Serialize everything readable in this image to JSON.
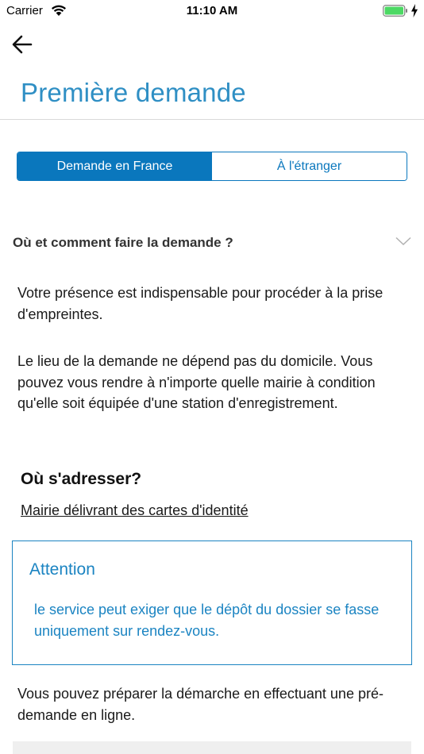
{
  "status_bar": {
    "carrier": "Carrier",
    "time": "11:10 AM"
  },
  "header": {
    "title": "Première demande",
    "back_icon": "arrow-left-icon"
  },
  "tabs": [
    {
      "label": "Demande en France",
      "active": true
    },
    {
      "label": "À l'étranger",
      "active": false
    }
  ],
  "section": {
    "title": "Où et comment faire la demande ?",
    "expanded": true
  },
  "content": {
    "paragraph1": "Votre présence est indispensable pour procéder à la prise d'empreintes.",
    "paragraph2": "Le lieu de la demande ne dépend pas du domicile. Vous pouvez vous rendre à n'importe quelle mairie à condition qu'elle soit équipée d'une station d'enregistrement.",
    "where_title": "Où s'adresser?",
    "where_link": "Mairie délivrant des cartes d'identité",
    "alert_title": "Attention",
    "alert_text": "le service peut exiger que le dépôt du dossier se fasse uniquement sur rendez-vous.",
    "paragraph3": "Vous pouvez préparer la démarche en effectuant une pré-demande en ligne."
  },
  "colors": {
    "accent": "#0a77bd",
    "title": "#2f8fc4",
    "battery": "#4cd964"
  }
}
